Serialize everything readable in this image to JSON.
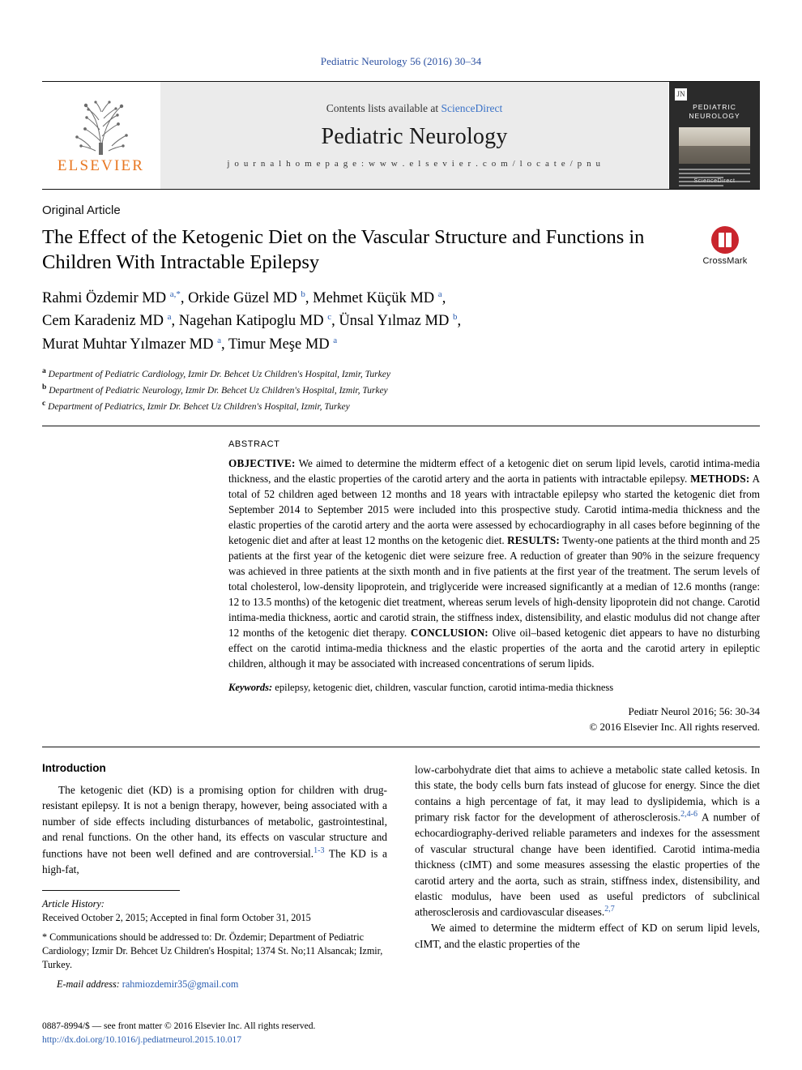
{
  "running_head": "Pediatric Neurology 56 (2016) 30–34",
  "masthead": {
    "publisher": "ELSEVIER",
    "contents_prefix": "Contents lists available at ",
    "contents_link": "ScienceDirect",
    "journal": "Pediatric Neurology",
    "homepage": "j o u r n a l   h o m e p a g e :   w w w . e l s e v i e r . c o m / l o c a t e / p n u",
    "cover_badge": "JN",
    "cover_title": "PEDIATRIC NEUROLOGY",
    "cover_footer": "ScienceDirect"
  },
  "article": {
    "type": "Original Article",
    "title": "The Effect of the Ketogenic Diet on the Vascular Structure and Functions in Children With Intractable Epilepsy",
    "crossmark_label": "CrossMark",
    "authors_html": "Rahmi Özdemir MD <sup>a,</sup><sup>*</sup>, Orkide Güzel MD <sup>b</sup>, Mehmet Küçük MD <sup>a</sup>,<br>Cem Karadeniz MD <sup>a</sup>, Nagehan Katipoglu MD <sup>c</sup>, Ünsal Yılmaz MD <sup>b</sup>,<br>Murat Muhtar Yılmazer MD <sup>a</sup>, Timur Meşe MD <sup>a</sup>",
    "affiliations": [
      {
        "marker": "a",
        "text": "Department of Pediatric Cardiology, Izmir Dr. Behcet Uz Children's Hospital, Izmir, Turkey"
      },
      {
        "marker": "b",
        "text": "Department of Pediatric Neurology, Izmir Dr. Behcet Uz Children's Hospital, Izmir, Turkey"
      },
      {
        "marker": "c",
        "text": "Department of Pediatrics, Izmir Dr. Behcet Uz Children's Hospital, Izmir, Turkey"
      }
    ]
  },
  "abstract": {
    "label": "ABSTRACT",
    "objective_label": "OBJECTIVE:",
    "objective_text": " We aimed to determine the midterm effect of a ketogenic diet on serum lipid levels, carotid intima-media thickness, and the elastic properties of the carotid artery and the aorta in patients with intractable epilepsy. ",
    "methods_label": "METHODS:",
    "methods_text": " A total of 52 children aged between 12 months and 18 years with intractable epilepsy who started the ketogenic diet from September 2014 to September 2015 were included into this prospective study. Carotid intima-media thickness and the elastic properties of the carotid artery and the aorta were assessed by echocardiography in all cases before beginning of the ketogenic diet and after at least 12 months on the ketogenic diet. ",
    "results_label": "RESULTS:",
    "results_text": " Twenty-one patients at the third month and 25 patients at the first year of the ketogenic diet were seizure free. A reduction of greater than 90% in the seizure frequency was achieved in three patients at the sixth month and in five patients at the first year of the treatment. The serum levels of total cholesterol, low-density lipoprotein, and triglyceride were increased significantly at a median of 12.6 months (range: 12 to 13.5 months) of the ketogenic diet treatment, whereas serum levels of high-density lipoprotein did not change. Carotid intima-media thickness, aortic and carotid strain, the stiffness index, distensibility, and elastic modulus did not change after 12 months of the ketogenic diet therapy. ",
    "conclusion_label": "CONCLUSION:",
    "conclusion_text": " Olive oil–based ketogenic diet appears to have no disturbing effect on the carotid intima-media thickness and the elastic properties of the aorta and the carotid artery in epileptic children, although it may be associated with increased concentrations of serum lipids.",
    "keywords_label": "Keywords:",
    "keywords_text": " epilepsy, ketogenic diet, children, vascular function, carotid intima-media thickness",
    "citation": "Pediatr Neurol 2016; 56: 30-34",
    "copyright": "© 2016 Elsevier Inc. All rights reserved."
  },
  "intro": {
    "heading": "Introduction",
    "para1_a": "The ketogenic diet (KD) is a promising option for children with drug-resistant epilepsy. It is not a benign therapy, however, being associated with a number of side effects including disturbances of metabolic, gastrointestinal, and renal functions. On the other hand, its effects on vascular structure and functions have not been well defined and are controversial.",
    "para1_ref": "1-3",
    "para1_b": " The KD is a high-fat,",
    "col2_a": "low-carbohydrate diet that aims to achieve a metabolic state called ketosis. In this state, the body cells burn fats instead of glucose for energy. Since the diet contains a high percentage of fat, it may lead to dyslipidemia, which is a primary risk factor for the development of atherosclerosis.",
    "col2_ref1": "2,4-6",
    "col2_b": " A number of echocardiography-derived reliable parameters and indexes for the assessment of vascular structural change have been identified. Carotid intima-media thickness (cIMT) and some measures assessing the elastic properties of the carotid artery and the aorta, such as strain, stiffness index, distensibility, and elastic modulus, have been used as useful predictors of subclinical atherosclerosis and cardiovascular diseases.",
    "col2_ref2": "2,7",
    "col2_para2": "We aimed to determine the midterm effect of KD on serum lipid levels, cIMT, and the elastic properties of the"
  },
  "footnotes": {
    "history_label": "Article History:",
    "history_text": "Received October 2, 2015; Accepted in final form October 31, 2015",
    "correspondence": "* Communications should be addressed to: Dr. Özdemir; Department of Pediatric Cardiology; Izmir Dr. Behcet Uz Children's Hospital; 1374 St. No;11 Alsancak; Izmir, Turkey.",
    "email_label": "E-mail address:",
    "email": "rahmiozdemir35@gmail.com"
  },
  "footer": {
    "issn_line": "0887-8994/$ — see front matter © 2016 Elsevier Inc. All rights reserved.",
    "doi": "http://dx.doi.org/10.1016/j.pediatrneurol.2015.10.017"
  }
}
